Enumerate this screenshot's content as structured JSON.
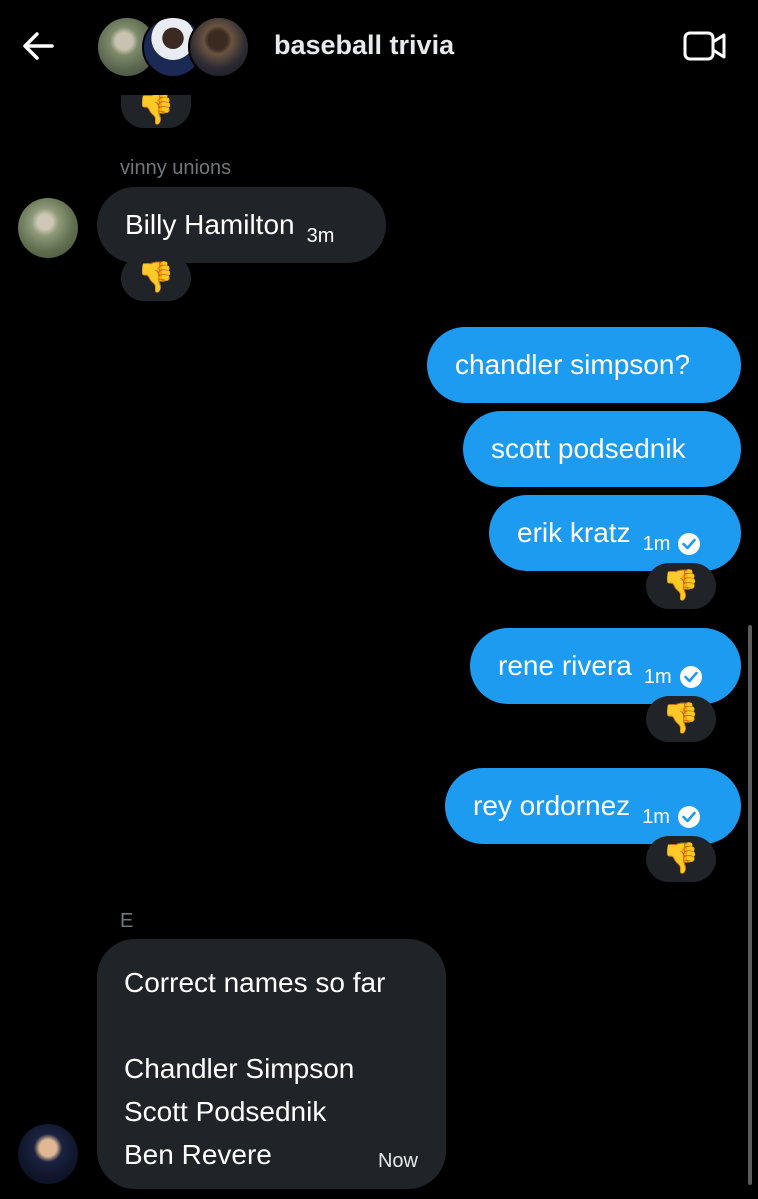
{
  "header": {
    "title": "baseball trivia",
    "back_icon": "arrow-left-icon",
    "video_icon": "video-camera-icon"
  },
  "messages": {
    "top_reaction": "👎",
    "vinny": {
      "sender": "vinny unions",
      "text": "Billy Hamilton",
      "time": "3m",
      "reaction": "👎"
    },
    "mine": [
      {
        "text": "chandler simpson?",
        "time": "",
        "reaction": ""
      },
      {
        "text": "scott podsednik",
        "time": "",
        "reaction": ""
      },
      {
        "text": "erik kratz",
        "time": "1m",
        "reaction": "👎"
      },
      {
        "text": "rene rivera",
        "time": "1m",
        "reaction": "👎"
      },
      {
        "text": "rey ordornez",
        "time": "1m",
        "reaction": "👎"
      }
    ],
    "e": {
      "sender": "E",
      "lines": [
        "Correct names so far",
        "",
        "Chandler Simpson",
        "Scott Podsednik",
        "Ben Revere"
      ],
      "time": "Now"
    }
  },
  "colors": {
    "background": "#000000",
    "outgoing_bubble": "#1d9bf0",
    "incoming_bubble": "#202327",
    "muted_text": "#71767b"
  }
}
